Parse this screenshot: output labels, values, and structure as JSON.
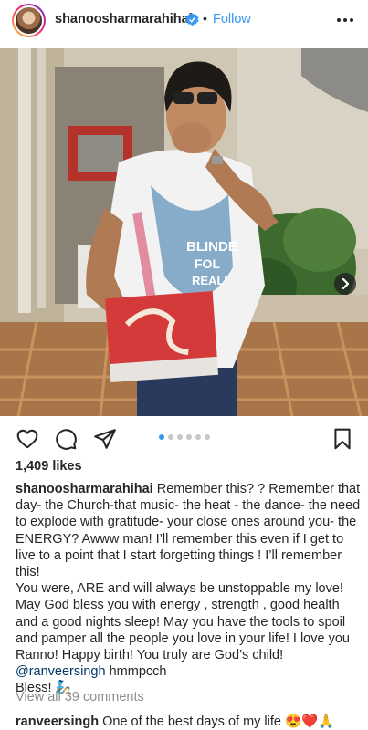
{
  "header": {
    "username": "shanoosharmarahihai",
    "separator": "•",
    "follow_label": "Follow"
  },
  "post": {
    "image_count": 6,
    "active_image": 1,
    "tshirt_text": [
      "BLINDE",
      "FOL",
      "REALI"
    ]
  },
  "likes": "1,409 likes",
  "caption": {
    "username": "shanoosharmarahihai",
    "text1": "Remember this? ? Remember that day- the Church-that music- the heat - the dance- the need to explode with gratitude- your close ones around you- the ENERGY? Awww man! I’ll remember this even if I get to live to a point that I start forgetting things ! I’ll remember this!",
    "text2": "You were, ARE and will always be unstoppable my love! May God bless you with energy , strength , good health and a good nights sleep! May you have the tools to spoil and pamper all the people you love in your life! I love you Ranno! Happy birth! You truly are God’s child!",
    "mention": "@ranveersingh",
    "after_mention": " hmmpcch",
    "closing": "Bless! 🧞"
  },
  "view_all_comments": "View all 39 comments",
  "comment": {
    "username": "ranveersingh",
    "text": "One of the best days of my life 😍❤️🙏"
  },
  "colors": {
    "follow_blue": "#3897f0",
    "mention": "#003569",
    "muted": "#8e8e8e",
    "text": "#262626"
  }
}
